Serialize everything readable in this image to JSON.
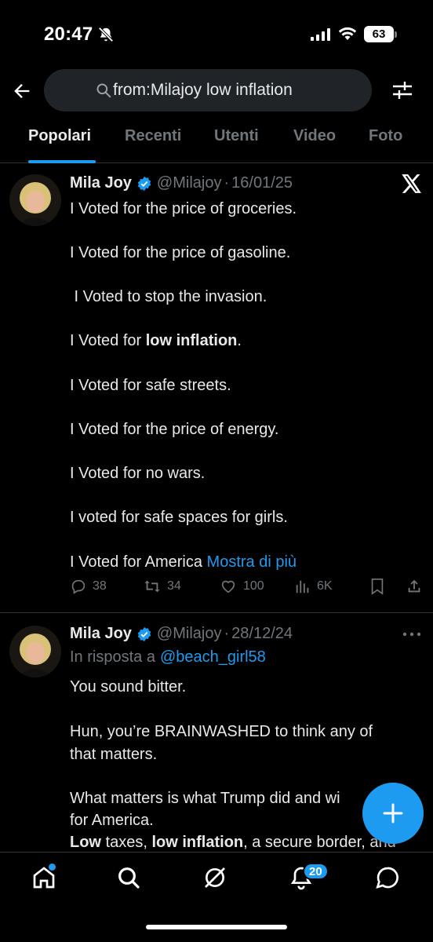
{
  "status_bar": {
    "time": "20:47",
    "battery": "63",
    "icons": [
      "bell-off-icon",
      "signal-icon",
      "wifi-icon",
      "battery-icon"
    ]
  },
  "search": {
    "query": "from:Milajoy low inflation"
  },
  "tabs": [
    {
      "label": "Popolari",
      "active": true
    },
    {
      "label": "Recenti",
      "active": false
    },
    {
      "label": "Utenti",
      "active": false
    },
    {
      "label": "Video",
      "active": false
    },
    {
      "label": "Foto",
      "active": false
    }
  ],
  "posts": [
    {
      "author": "Mila Joy",
      "handle": "@Milajoy",
      "separator": "·",
      "date": "16/01/25",
      "lines": [
        "I Voted for the price of groceries.",
        "I Voted for the price of gasoline.",
        " I Voted to stop the invasion.",
        {
          "pre": "I Voted for ",
          "bold": "low inflation",
          "post": "."
        },
        "I Voted for safe streets.",
        "I Voted for the price of energy.",
        "I Voted for no wars.",
        "I voted for safe spaces for girls.",
        "I Voted for America"
      ],
      "show_more": "Mostra di più",
      "actions": {
        "replies": "38",
        "reposts": "34",
        "likes": "100",
        "views": "6K"
      }
    },
    {
      "author": "Mila Joy",
      "handle": "@Milajoy",
      "separator": "·",
      "date": "28/12/24",
      "reply_label": "In risposta a",
      "reply_to": "@beach_girl58",
      "lines": [
        "You sound bitter.",
        "Hun, you’re BRAINWASHED to think any of",
        "that matters.",
        "What matters is what Trump did and wi",
        "for America.",
        {
          "b1": "Low",
          "t1": " taxes, ",
          "b2": "low inflation",
          "t2": ", a secure border, and"
        }
      ]
    }
  ],
  "bottom_nav": {
    "notifications_badge": "20",
    "items": [
      "home-icon",
      "search-icon",
      "grok-icon",
      "notifications-icon",
      "messages-icon"
    ]
  },
  "colors": {
    "accent": "#1d9bf0",
    "background": "#000000",
    "muted": "#71767b",
    "text": "#e7e9ea"
  }
}
